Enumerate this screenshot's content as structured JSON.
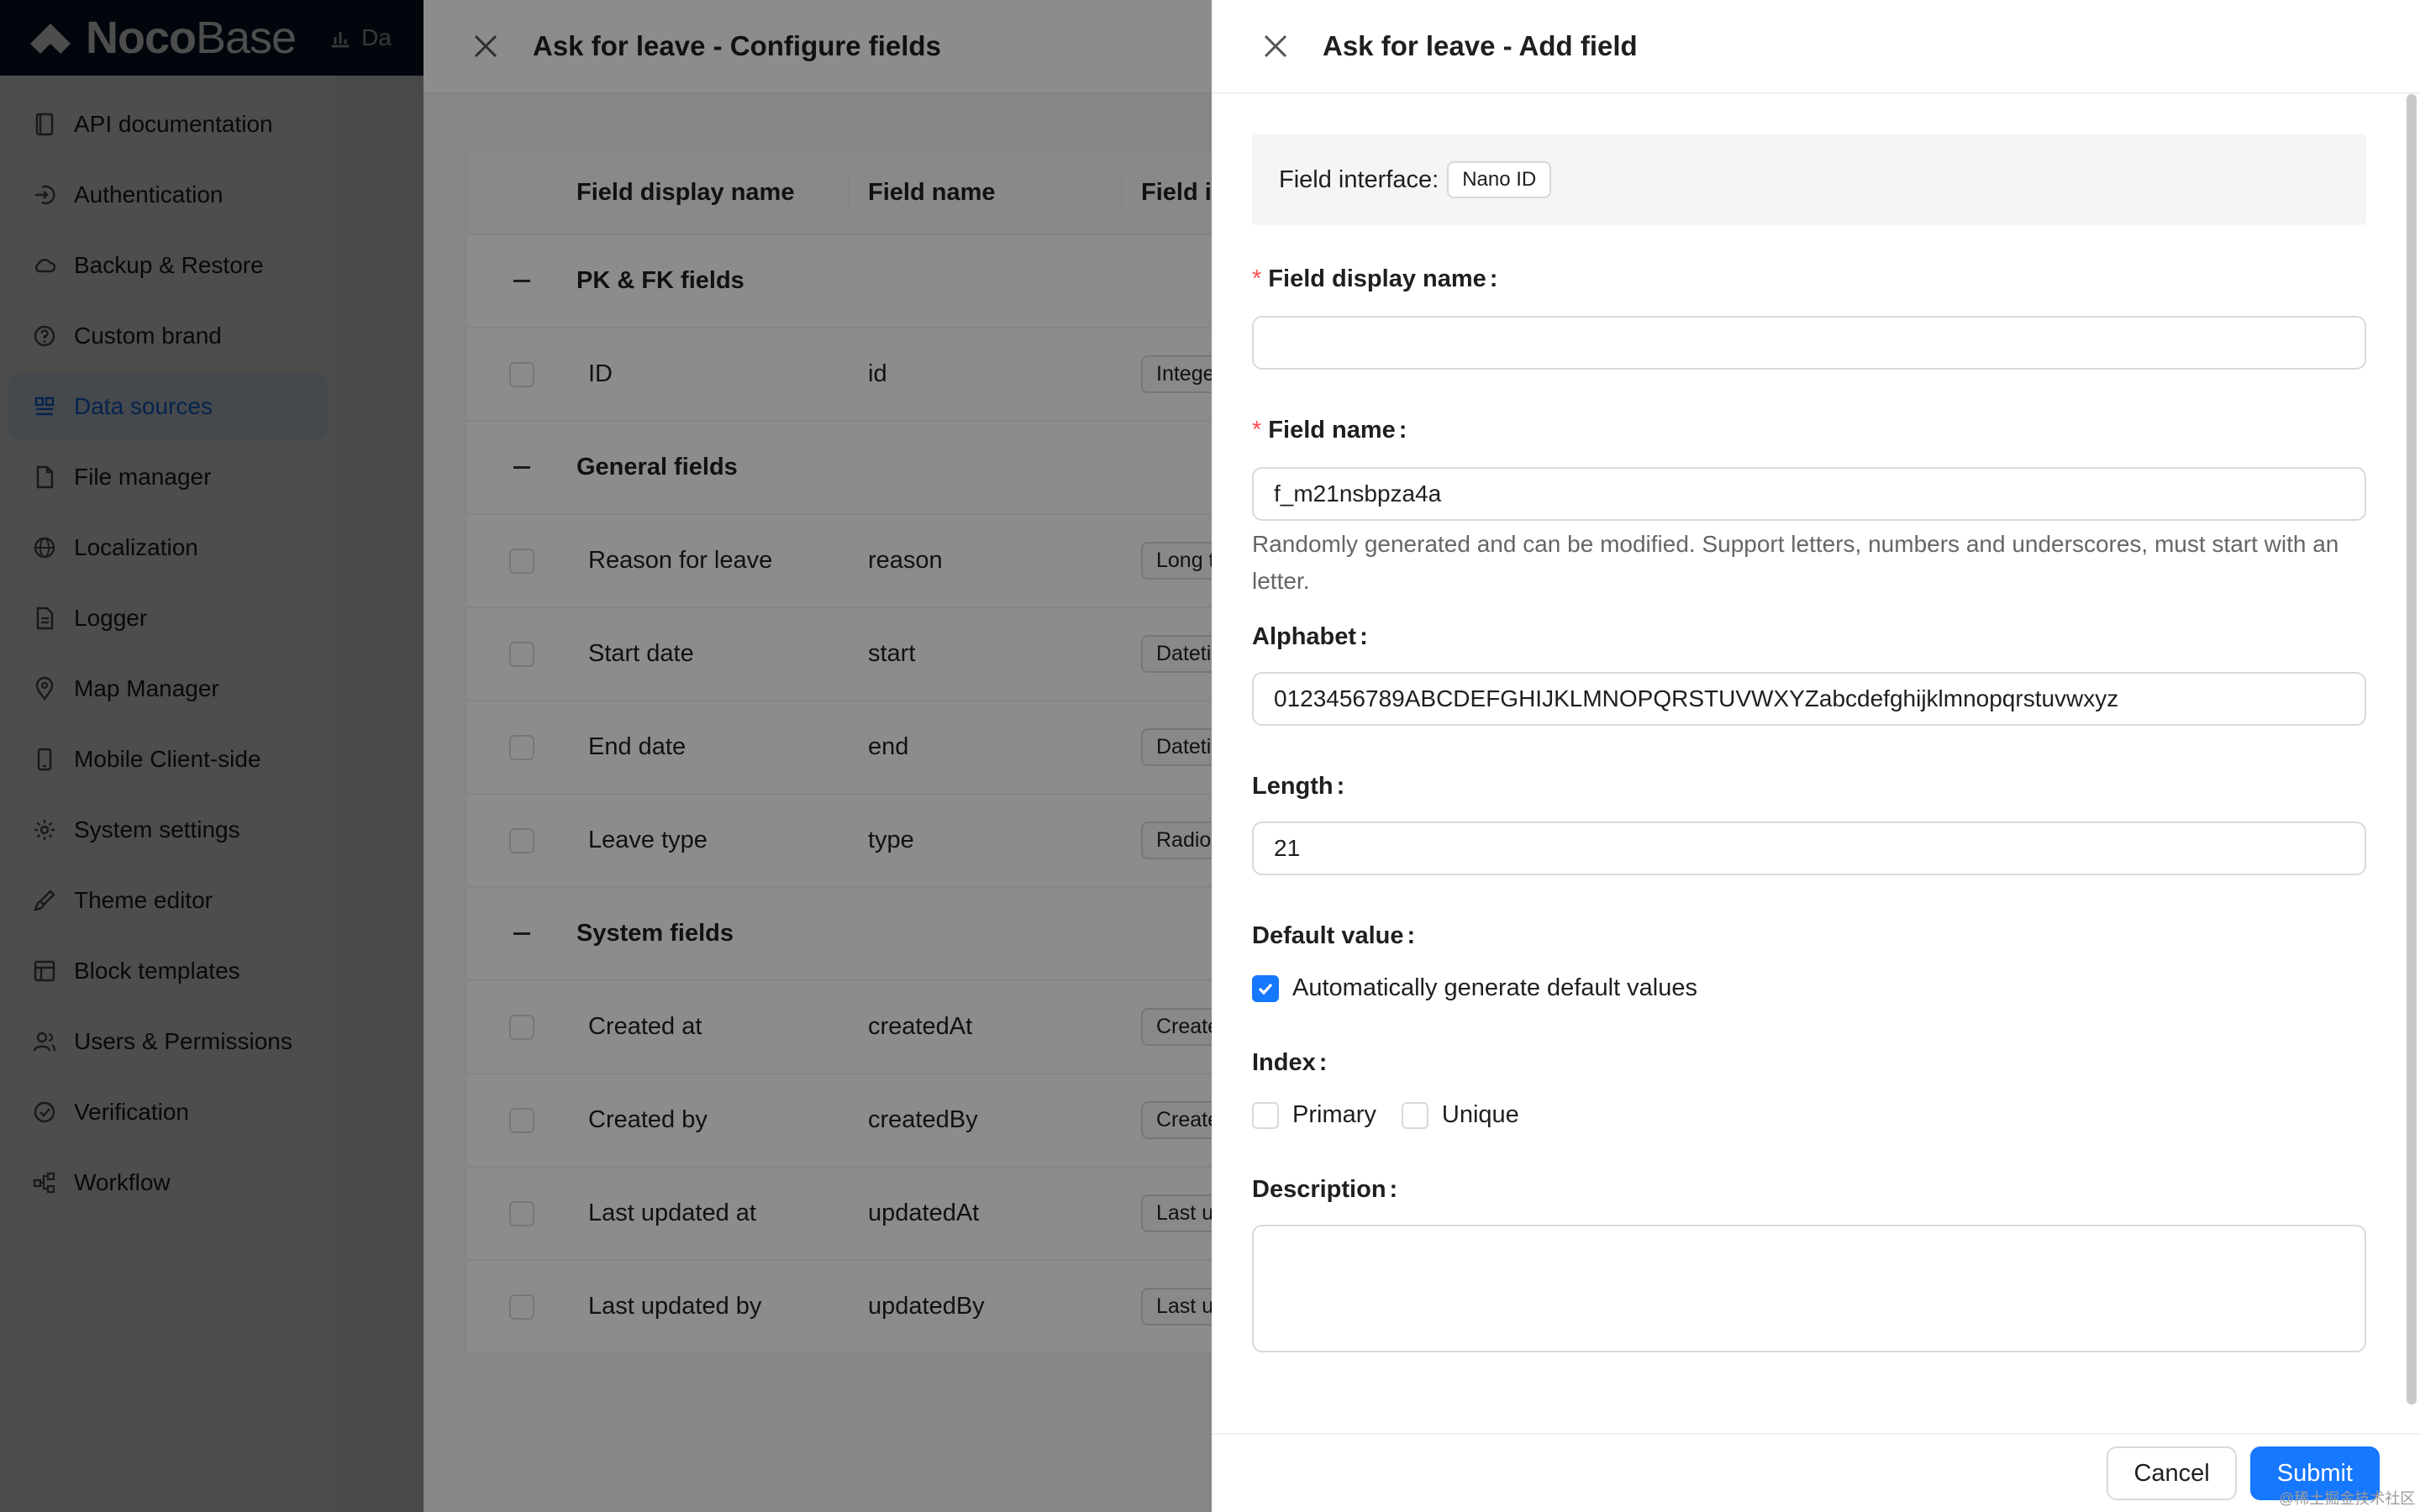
{
  "app": {
    "logo_bold": "Noco",
    "logo_light": "Base",
    "top_nav_label": "Da"
  },
  "sidebar": {
    "items": [
      {
        "label": "API documentation",
        "icon": "book-icon"
      },
      {
        "label": "Authentication",
        "icon": "login-icon"
      },
      {
        "label": "Backup & Restore",
        "icon": "cloud-icon"
      },
      {
        "label": "Custom brand",
        "icon": "question-circle-icon"
      },
      {
        "label": "Data sources",
        "icon": "database-icon"
      },
      {
        "label": "File manager",
        "icon": "file-icon"
      },
      {
        "label": "Localization",
        "icon": "globe-icon"
      },
      {
        "label": "Logger",
        "icon": "file-text-icon"
      },
      {
        "label": "Map Manager",
        "icon": "map-pin-icon"
      },
      {
        "label": "Mobile Client-side",
        "icon": "mobile-icon"
      },
      {
        "label": "System settings",
        "icon": "gear-icon"
      },
      {
        "label": "Theme editor",
        "icon": "brush-icon"
      },
      {
        "label": "Block templates",
        "icon": "layout-icon"
      },
      {
        "label": "Users & Permissions",
        "icon": "users-icon"
      },
      {
        "label": "Verification",
        "icon": "check-circle-icon"
      },
      {
        "label": "Workflow",
        "icon": "workflow-icon"
      }
    ],
    "active_index": 4
  },
  "configure_drawer": {
    "title": "Ask for leave - Configure fields",
    "columns": {
      "display_name": "Field display name",
      "field_name": "Field name",
      "interface": "Field int"
    },
    "groups": [
      {
        "label": "PK & FK fields",
        "rows": [
          {
            "display": "ID",
            "name": "id",
            "interface": "Integer"
          }
        ]
      },
      {
        "label": "General fields",
        "rows": [
          {
            "display": "Reason for leave",
            "name": "reason",
            "interface": "Long tex"
          },
          {
            "display": "Start date",
            "name": "start",
            "interface": "Datetim"
          },
          {
            "display": "End date",
            "name": "end",
            "interface": "Datetim"
          },
          {
            "display": "Leave type",
            "name": "type",
            "interface": "Radio gr"
          }
        ]
      },
      {
        "label": "System fields",
        "rows": [
          {
            "display": "Created at",
            "name": "createdAt",
            "interface": "Created"
          },
          {
            "display": "Created by",
            "name": "createdBy",
            "interface": "Created"
          },
          {
            "display": "Last updated at",
            "name": "updatedAt",
            "interface": "Last upd"
          },
          {
            "display": "Last updated by",
            "name": "updatedBy",
            "interface": "Last upd"
          }
        ]
      }
    ]
  },
  "add_field_drawer": {
    "title": "Ask for leave - Add field",
    "field_interface_label": "Field interface:",
    "field_interface_value": "Nano ID",
    "display_name_label": "Field display name",
    "display_name_value": "",
    "field_name_label": "Field name",
    "field_name_value": "f_m21nsbpza4a",
    "field_name_help": "Randomly generated and can be modified. Support letters, numbers and underscores, must start with an letter.",
    "alphabet_label": "Alphabet",
    "alphabet_value": "0123456789ABCDEFGHIJKLMNOPQRSTUVWXYZabcdefghijklmnopqrstuvwxyz",
    "length_label": "Length",
    "length_value": "21",
    "default_value_label": "Default value",
    "auto_generate_label": "Automatically generate default values",
    "auto_generate_checked": true,
    "index_label": "Index",
    "index_primary_label": "Primary",
    "index_unique_label": "Unique",
    "description_label": "Description",
    "label_colon": ":",
    "cancel_label": "Cancel",
    "submit_label": "Submit",
    "watermark": "@稀土掘金技术社区"
  },
  "colors": {
    "primary": "#1677ff",
    "required": "#ff4d4f",
    "topbar": "#001529"
  }
}
